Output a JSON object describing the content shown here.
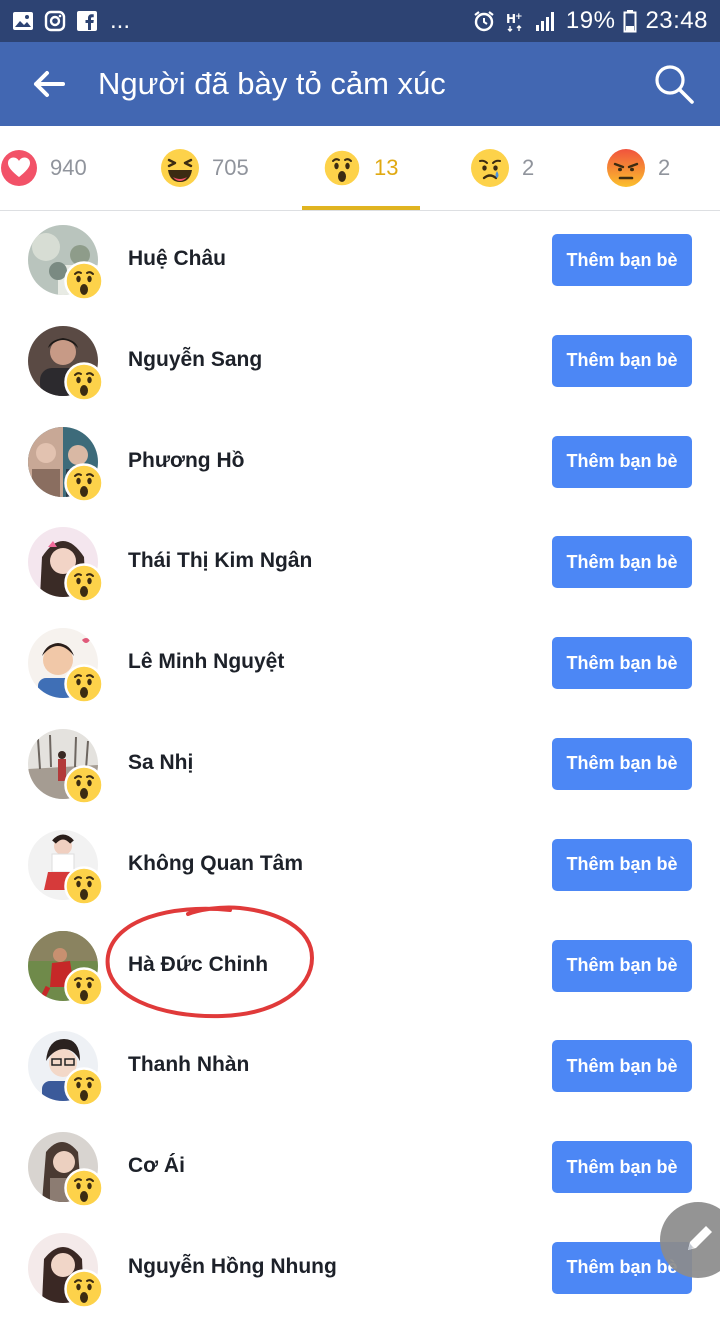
{
  "status_bar": {
    "left_icons": [
      "image-icon",
      "instagram-icon",
      "facebook-icon"
    ],
    "overflow": "...",
    "battery_percent": "19%",
    "time": "23:48"
  },
  "app_bar": {
    "title": "Người đã bày tỏ cảm xúc",
    "back_icon": "back-arrow-icon",
    "search_icon": "search-icon"
  },
  "tabs": [
    {
      "reaction": "love",
      "count": "940"
    },
    {
      "reaction": "haha",
      "count": "705"
    },
    {
      "reaction": "wow",
      "count": "13",
      "active": true
    },
    {
      "reaction": "sad",
      "count": "2"
    },
    {
      "reaction": "angry",
      "count": "2"
    }
  ],
  "people": [
    {
      "name": "Huệ Châu",
      "button": "Thêm bạn bè"
    },
    {
      "name": "Nguyễn Sang",
      "button": "Thêm bạn bè"
    },
    {
      "name": "Phương Hồ",
      "button": "Thêm bạn bè"
    },
    {
      "name": "Thái Thị Kim Ngân",
      "button": "Thêm bạn bè"
    },
    {
      "name": "Lê Minh Nguyệt",
      "button": "Thêm bạn bè"
    },
    {
      "name": "Sa Nhị",
      "button": "Thêm bạn bè"
    },
    {
      "name": "Không Quan Tâm",
      "button": "Thêm bạn bè"
    },
    {
      "name": "Hà Đức Chinh",
      "button": "Thêm bạn bè"
    },
    {
      "name": "Thanh Nhàn",
      "button": "Thêm bạn bè"
    },
    {
      "name": "Cơ Ái",
      "button": "Thêm bạn bè"
    },
    {
      "name": "Nguyễn Hồng Nhung",
      "button": "Thêm bạn bè"
    }
  ],
  "colors": {
    "status_bar": "#2d4373",
    "app_bar": "#4267b2",
    "active_tab": "#e0a912",
    "add_button": "#4c87f5",
    "annotation": "#e03a3a"
  }
}
